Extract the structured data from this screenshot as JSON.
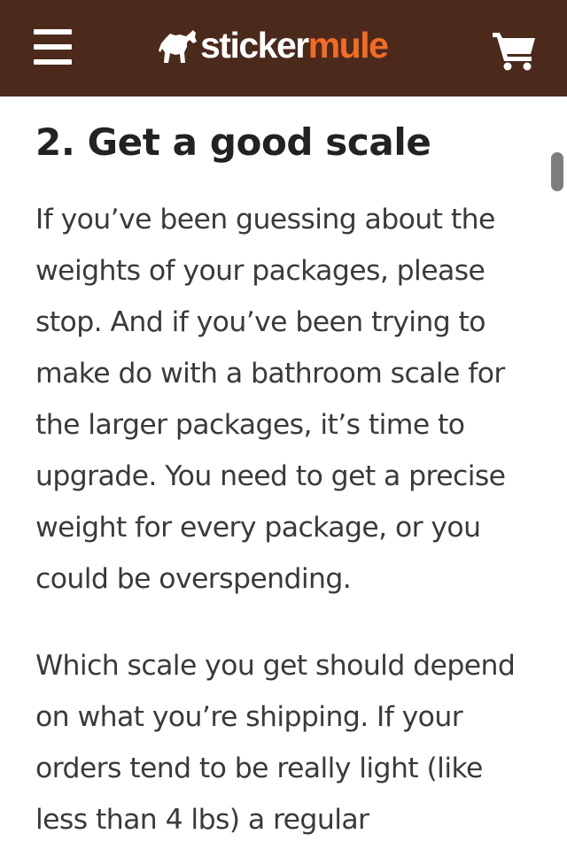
{
  "header": {
    "logo_word1": "sticker",
    "logo_word2": "mule",
    "brand_color": "#4b2a1c",
    "accent_color": "#f26c24",
    "menu_icon": "hamburger-menu-icon",
    "cart_icon": "shopping-cart-icon"
  },
  "article": {
    "heading": "2. Get a good scale",
    "paragraph1": "If you’ve been guessing about the weights of your packages, please stop. And if you’ve been trying to make do with a bathroom scale for the larger packages, it’s time to upgrade. You need to get a precise weight for every package, or you could be overspending.",
    "paragraph2": "Which scale you get should depend on what you’re shipping. If your orders tend to be really light (like less than 4 lbs) a regular"
  }
}
